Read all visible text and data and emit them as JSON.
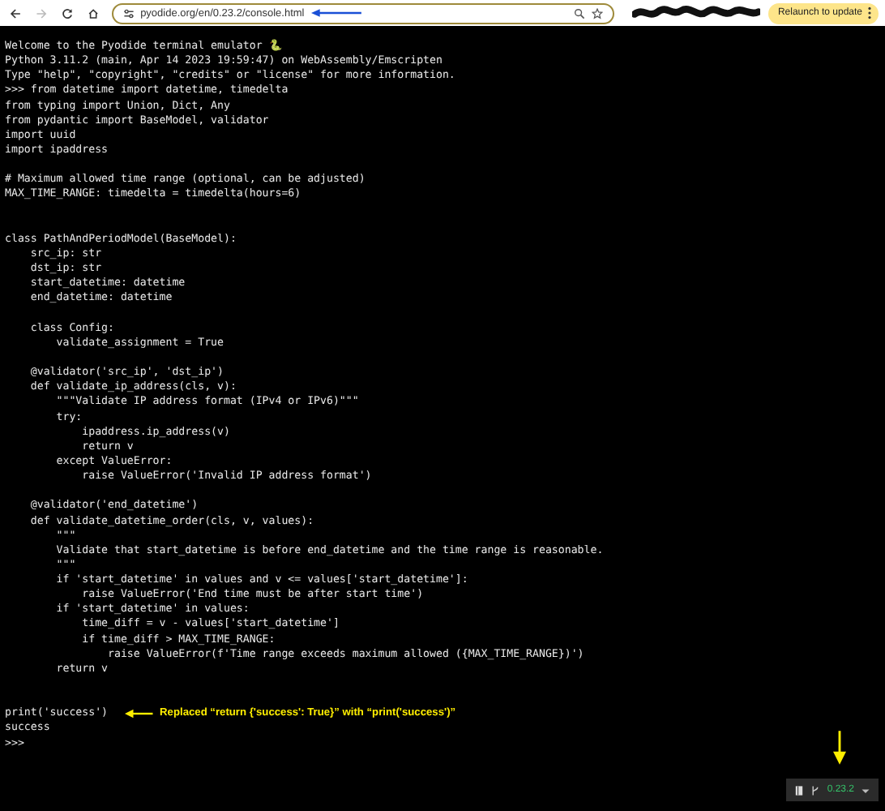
{
  "toolbar": {
    "forward_disabled": true,
    "url": "pyodide.org/en/0.23.2/console.html",
    "relaunch_button": "Relaunch to update"
  },
  "terminal": {
    "lines": [
      {
        "kind": "code",
        "text": "Welcome to the Pyodide terminal emulator 🐍"
      },
      {
        "kind": "code",
        "text": "Python 3.11.2 (main, Apr 14 2023 19:59:47) on WebAssembly/Emscripten"
      },
      {
        "kind": "code",
        "text": "Type \"help\", \"copyright\", \"credits\" or \"license\" for more information."
      },
      {
        "kind": "code",
        "text": ">>> from datetime import datetime, timedelta"
      },
      {
        "kind": "code",
        "text": "from typing import Union, Dict, Any"
      },
      {
        "kind": "code",
        "text": "from pydantic import BaseModel, validator"
      },
      {
        "kind": "code",
        "text": "import uuid"
      },
      {
        "kind": "code",
        "text": "import ipaddress"
      },
      {
        "kind": "blank"
      },
      {
        "kind": "code",
        "text": "# Maximum allowed time range (optional, can be adjusted)"
      },
      {
        "kind": "code",
        "text": "MAX_TIME_RANGE: timedelta = timedelta(hours=6)"
      },
      {
        "kind": "blank"
      },
      {
        "kind": "blank"
      },
      {
        "kind": "code",
        "text": "class PathAndPeriodModel(BaseModel):"
      },
      {
        "kind": "code",
        "text": "    src_ip: str"
      },
      {
        "kind": "code",
        "text": "    dst_ip: str"
      },
      {
        "kind": "code",
        "text": "    start_datetime: datetime"
      },
      {
        "kind": "code",
        "text": "    end_datetime: datetime"
      },
      {
        "kind": "blank"
      },
      {
        "kind": "code",
        "text": "    class Config:"
      },
      {
        "kind": "code",
        "text": "        validate_assignment = True"
      },
      {
        "kind": "blank"
      },
      {
        "kind": "code",
        "text": "    @validator('src_ip', 'dst_ip')"
      },
      {
        "kind": "code",
        "text": "    def validate_ip_address(cls, v):"
      },
      {
        "kind": "code",
        "text": "        \"\"\"Validate IP address format (IPv4 or IPv6)\"\"\""
      },
      {
        "kind": "code",
        "text": "        try:"
      },
      {
        "kind": "code",
        "text": "            ipaddress.ip_address(v)"
      },
      {
        "kind": "code",
        "text": "            return v"
      },
      {
        "kind": "code",
        "text": "        except ValueError:"
      },
      {
        "kind": "code",
        "text": "            raise ValueError('Invalid IP address format')"
      },
      {
        "kind": "blank"
      },
      {
        "kind": "code",
        "text": "    @validator('end_datetime')"
      },
      {
        "kind": "code",
        "text": "    def validate_datetime_order(cls, v, values):"
      },
      {
        "kind": "code",
        "text": "        \"\"\""
      },
      {
        "kind": "code",
        "text": "        Validate that start_datetime is before end_datetime and the time range is reasonable."
      },
      {
        "kind": "code",
        "text": "        \"\"\""
      },
      {
        "kind": "code",
        "text": "        if 'start_datetime' in values and v <= values['start_datetime']:"
      },
      {
        "kind": "code",
        "text": "            raise ValueError('End time must be after start time')"
      },
      {
        "kind": "code",
        "text": "        if 'start_datetime' in values:"
      },
      {
        "kind": "code",
        "text": "            time_diff = v - values['start_datetime']"
      },
      {
        "kind": "code",
        "text": "            if time_diff > MAX_TIME_RANGE:"
      },
      {
        "kind": "code",
        "text": "                raise ValueError(f'Time range exceeds maximum allowed ({MAX_TIME_RANGE})')"
      },
      {
        "kind": "code",
        "text": "        return v"
      },
      {
        "kind": "blank"
      },
      {
        "kind": "blank"
      },
      {
        "kind": "code",
        "text": "print('success')",
        "annotation": "Replaced “return {'success': True}” with “print('success')”"
      },
      {
        "kind": "code",
        "text": "success"
      },
      {
        "kind": "code",
        "text": ">>>"
      }
    ]
  },
  "version_widget": {
    "version": "0.23.2"
  }
}
